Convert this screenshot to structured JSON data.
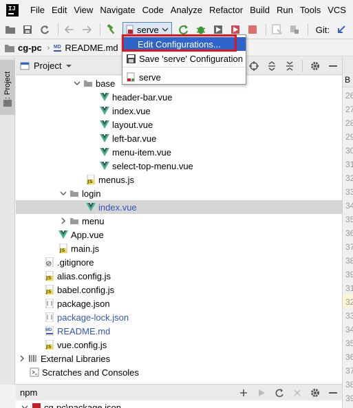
{
  "menubar": {
    "items": [
      "File",
      "Edit",
      "View",
      "Navigate",
      "Code",
      "Analyze",
      "Refactor",
      "Build",
      "Run",
      "Tools",
      "VCS"
    ],
    "logo_text": "IJ"
  },
  "toolbar": {
    "run_config": "serve",
    "git_label": "Git:"
  },
  "navbar": {
    "crumbs": [
      "cg-pc",
      "README.md"
    ],
    "readme_badge": "MD"
  },
  "side_strip": {
    "tab_label": "1: Project"
  },
  "project_panel": {
    "title": "Project"
  },
  "tree": {
    "rows": [
      {
        "label": "base"
      },
      {
        "label": "header-bar.vue"
      },
      {
        "label": "index.vue"
      },
      {
        "label": "layout.vue"
      },
      {
        "label": "left-bar.vue"
      },
      {
        "label": "menu-item.vue"
      },
      {
        "label": "select-top-menu.vue"
      },
      {
        "label": "menus.js"
      },
      {
        "label": "login"
      },
      {
        "label": "index.vue"
      },
      {
        "label": "menu"
      },
      {
        "label": "App.vue"
      },
      {
        "label": "main.js"
      },
      {
        "label": ".gitignore"
      },
      {
        "label": "alias.config.js"
      },
      {
        "label": "babel.config.js"
      },
      {
        "label": "package.json"
      },
      {
        "label": "package-lock.json"
      },
      {
        "label": "README.md"
      },
      {
        "label": "vue.config.js"
      },
      {
        "label": "External Libraries"
      },
      {
        "label": "Scratches and Consoles"
      }
    ],
    "js_badge": "JS",
    "md_badge": "MD"
  },
  "gutter": {
    "tab_label": "B",
    "line_numbers": [
      "26",
      "27",
      "28",
      "29",
      "30",
      "31",
      "32",
      "33",
      "34",
      "35",
      "36",
      "37",
      "38",
      "39",
      "31",
      "32",
      "33",
      "34",
      "35",
      "36",
      "37",
      "38",
      "39"
    ]
  },
  "npm_panel": {
    "title": "npm",
    "row_label": "cg-pc\\package.json"
  },
  "popup": {
    "items": [
      "Edit Configurations...",
      "Save 'serve' Configuration",
      "serve"
    ]
  },
  "colors": {
    "vue_green": "#41b883",
    "vue_dark": "#35495e",
    "selection_blue": "#2f65ca",
    "highlight_red": "#e8121b",
    "link_blue": "#2f55b8"
  }
}
